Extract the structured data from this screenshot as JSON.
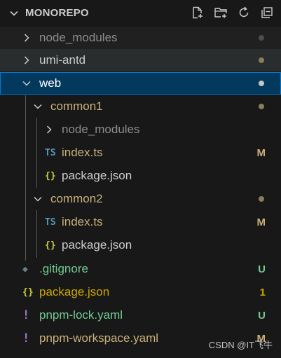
{
  "explorer": {
    "title": "MONOREPO",
    "actions": [
      {
        "name": "new-file-icon"
      },
      {
        "name": "new-folder-icon"
      },
      {
        "name": "refresh-icon"
      },
      {
        "name": "collapse-all-icon"
      }
    ]
  },
  "tree": [
    {
      "label": "node_modules",
      "kind": "folder",
      "expanded": false,
      "status_dot": "#4d4d4d",
      "label_color": "#8c8c8c"
    },
    {
      "label": "umi-antd",
      "kind": "folder",
      "expanded": false,
      "status_dot": "#8a7d5b",
      "label_color": "#cccccc"
    },
    {
      "label": "web",
      "kind": "folder",
      "expanded": true,
      "status_dot": "#c5c5c5",
      "label_color": "#ffffff"
    },
    {
      "label": "common1",
      "kind": "folder",
      "expanded": true,
      "status_dot": "#8a7d5b",
      "label_color": "#c9b07a"
    },
    {
      "label": "node_modules",
      "kind": "folder",
      "expanded": false,
      "label_color": "#8c8c8c"
    },
    {
      "label": "index.ts",
      "kind": "file",
      "icon_text": "TS",
      "icon_color": "#519aba",
      "badge": "M",
      "label_color": "#c9b07a",
      "badge_color": "#c9b07a"
    },
    {
      "label": "package.json",
      "kind": "file",
      "icon_text": "{}",
      "icon_color": "#cbcb41",
      "label_color": "#cccccc"
    },
    {
      "label": "common2",
      "kind": "folder",
      "expanded": true,
      "status_dot": "#8a7d5b",
      "label_color": "#c9b07a"
    },
    {
      "label": "index.ts",
      "kind": "file",
      "icon_text": "TS",
      "icon_color": "#519aba",
      "badge": "M",
      "label_color": "#c9b07a",
      "badge_color": "#c9b07a"
    },
    {
      "label": "package.json",
      "kind": "file",
      "icon_text": "{}",
      "icon_color": "#cbcb41",
      "label_color": "#cccccc"
    },
    {
      "label": ".gitignore",
      "kind": "file",
      "icon_text": "◆",
      "icon_color": "#6d8086",
      "badge": "U",
      "label_color": "#73c991",
      "badge_color": "#73c991"
    },
    {
      "label": "package.json",
      "kind": "file",
      "icon_text": "{}",
      "icon_color": "#cbcb41",
      "badge": "1",
      "label_color": "#cca700",
      "badge_color": "#cca700"
    },
    {
      "label": "pnpm-lock.yaml",
      "kind": "file",
      "icon_text": "!",
      "icon_color": "#a074c4",
      "badge": "U",
      "label_color": "#73c991",
      "badge_color": "#73c991"
    },
    {
      "label": "pnpm-workspace.yaml",
      "kind": "file",
      "icon_text": "!",
      "icon_color": "#a074c4",
      "badge": "M",
      "label_color": "#c9b07a",
      "badge_color": "#c9b07a"
    }
  ],
  "watermark": "CSDN @IT飞牛"
}
